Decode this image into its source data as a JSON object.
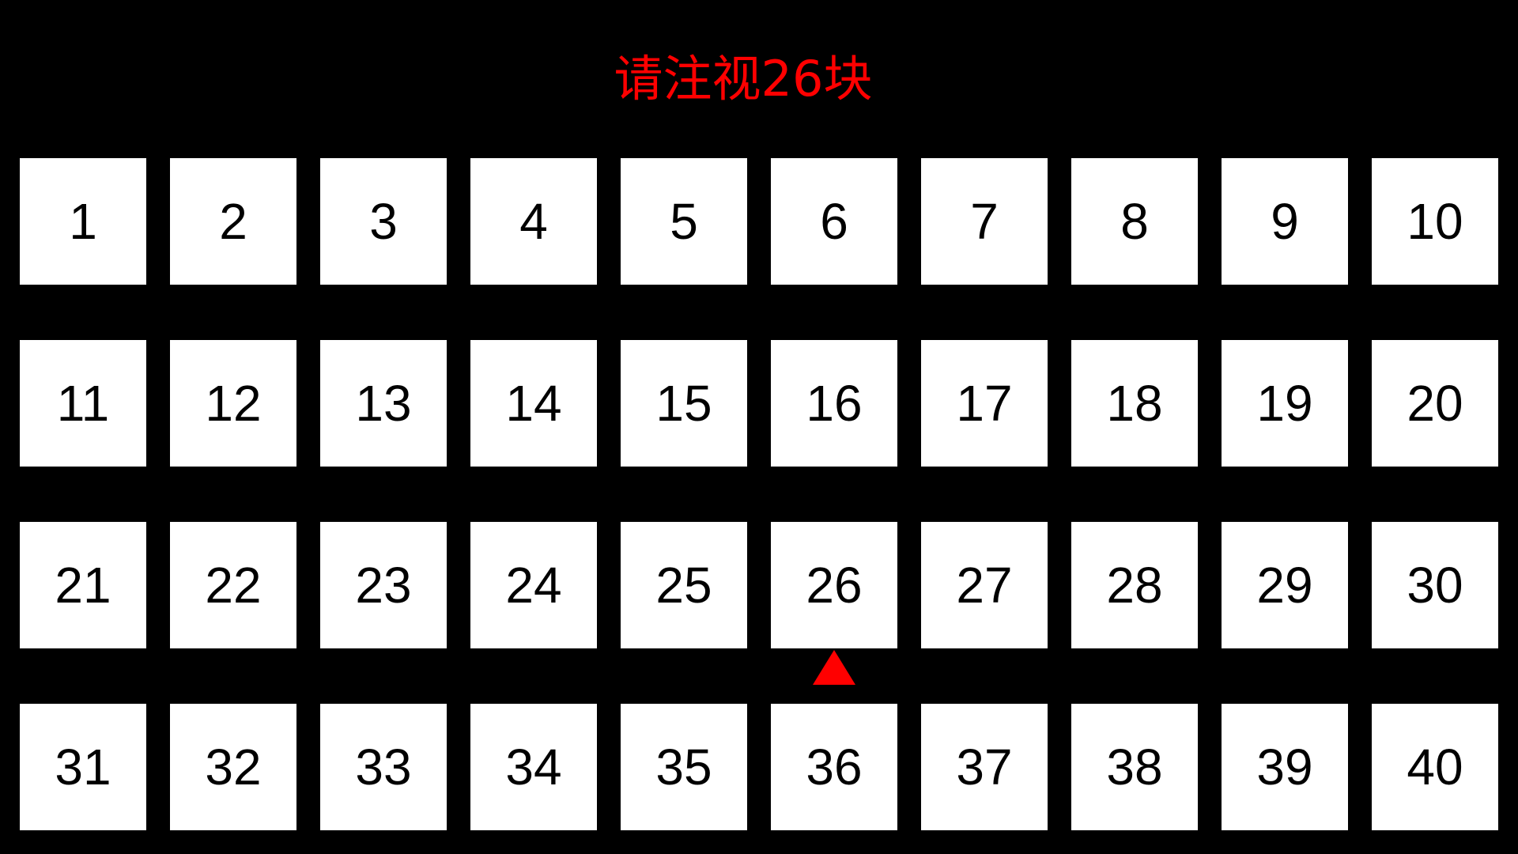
{
  "instruction": "请注视26块",
  "colors": {
    "background": "#000000",
    "tile": "#ffffff",
    "tile_text": "#000000",
    "accent": "#ff0000"
  },
  "target_block": "26",
  "target_marker_icon": "triangle-up-icon",
  "tiles": [
    "1",
    "2",
    "3",
    "4",
    "5",
    "6",
    "7",
    "8",
    "9",
    "10",
    "11",
    "12",
    "13",
    "14",
    "15",
    "16",
    "17",
    "18",
    "19",
    "20",
    "21",
    "22",
    "23",
    "24",
    "25",
    "26",
    "27",
    "28",
    "29",
    "30",
    "31",
    "32",
    "33",
    "34",
    "35",
    "36",
    "37",
    "38",
    "39",
    "40"
  ]
}
